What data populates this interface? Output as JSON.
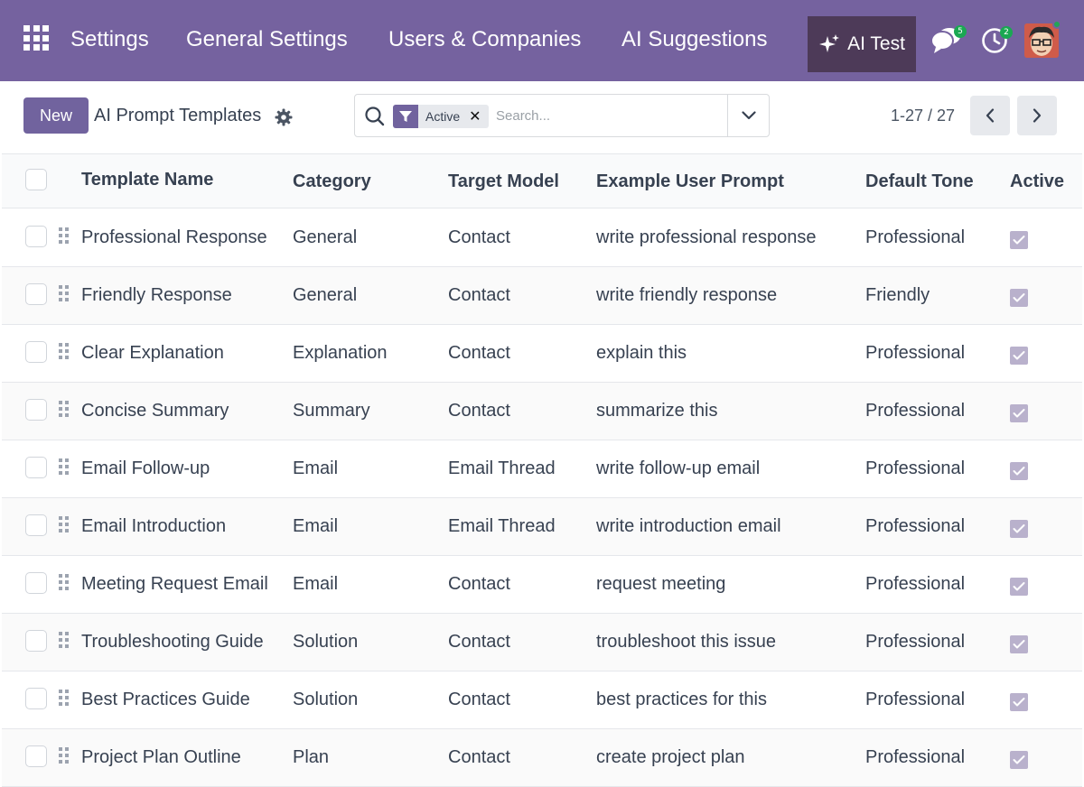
{
  "navbar": {
    "menu": [
      "Settings",
      "General Settings",
      "Users & Companies",
      "AI Suggestions"
    ],
    "ai_test_label": "AI Test",
    "messages_count": "5",
    "activities_count": "2",
    "colors": {
      "bar": "#75629f",
      "ai_test_bg": "#4d3a58",
      "badge": "#1aa852"
    }
  },
  "control": {
    "new_label": "New",
    "breadcrumb": "AI Prompt Templates",
    "search": {
      "facet_value": "Active",
      "placeholder": "Search..."
    },
    "pager_value": "1-27 / 27"
  },
  "table": {
    "columns": [
      "Template Name",
      "Category",
      "Target Model",
      "Example User Prompt",
      "Default Tone",
      "Active"
    ],
    "rows": [
      {
        "name": "Professional Response",
        "category": "General",
        "model": "Contact",
        "prompt": "write professional response",
        "tone": "Professional",
        "active": true
      },
      {
        "name": "Friendly Response",
        "category": "General",
        "model": "Contact",
        "prompt": "write friendly response",
        "tone": "Friendly",
        "active": true
      },
      {
        "name": "Clear Explanation",
        "category": "Explanation",
        "model": "Contact",
        "prompt": "explain this",
        "tone": "Professional",
        "active": true
      },
      {
        "name": "Concise Summary",
        "category": "Summary",
        "model": "Contact",
        "prompt": "summarize this",
        "tone": "Professional",
        "active": true
      },
      {
        "name": "Email Follow-up",
        "category": "Email",
        "model": "Email Thread",
        "prompt": "write follow-up email",
        "tone": "Professional",
        "active": true
      },
      {
        "name": "Email Introduction",
        "category": "Email",
        "model": "Email Thread",
        "prompt": "write introduction email",
        "tone": "Professional",
        "active": true
      },
      {
        "name": "Meeting Request Email",
        "category": "Email",
        "model": "Contact",
        "prompt": "request meeting",
        "tone": "Professional",
        "active": true
      },
      {
        "name": "Troubleshooting Guide",
        "category": "Solution",
        "model": "Contact",
        "prompt": "troubleshoot this issue",
        "tone": "Professional",
        "active": true
      },
      {
        "name": "Best Practices Guide",
        "category": "Solution",
        "model": "Contact",
        "prompt": "best practices for this",
        "tone": "Professional",
        "active": true
      },
      {
        "name": "Project Plan Outline",
        "category": "Plan",
        "model": "Contact",
        "prompt": "create project plan",
        "tone": "Professional",
        "active": true
      }
    ]
  }
}
